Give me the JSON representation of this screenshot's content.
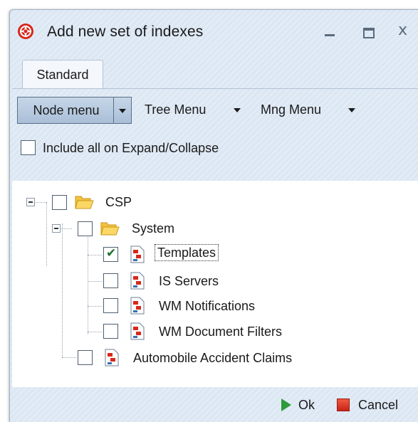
{
  "window": {
    "title": "Add new set of indexes",
    "icon": "app-logo-icon",
    "controls": [
      "minimize-icon",
      "maximize-icon",
      "close-icon"
    ]
  },
  "tabs": [
    {
      "label": "Standard",
      "active": true
    }
  ],
  "toolbar": {
    "node_menu": "Node menu",
    "tree_menu": "Tree Menu",
    "mng_menu": "Mng Menu"
  },
  "include_all": {
    "label": "Include all on Expand/Collapse",
    "checked": false
  },
  "tree": {
    "root": {
      "label": "CSP",
      "checked": false,
      "icon": "folder-icon"
    },
    "system": {
      "label": "System",
      "checked": false,
      "icon": "folder-icon"
    },
    "children": [
      {
        "label": "Templates",
        "checked": true,
        "icon": "document-icon",
        "selected": true
      },
      {
        "label": "IS Servers",
        "checked": false,
        "icon": "document-icon"
      },
      {
        "label": "WM Notifications",
        "checked": false,
        "icon": "document-icon"
      },
      {
        "label": "WM Document Filters",
        "checked": false,
        "icon": "document-icon"
      }
    ],
    "sibling": {
      "label": "Automobile Accident Claims",
      "checked": false,
      "icon": "document-icon"
    }
  },
  "footer": {
    "ok_label": "Ok",
    "cancel_label": "Cancel"
  },
  "colors": {
    "window_bg": "#e2ecf6",
    "accent_ok": "#2e9a3a",
    "accent_cancel": "#d42a1c",
    "button_pressed": "#b4c8de"
  }
}
